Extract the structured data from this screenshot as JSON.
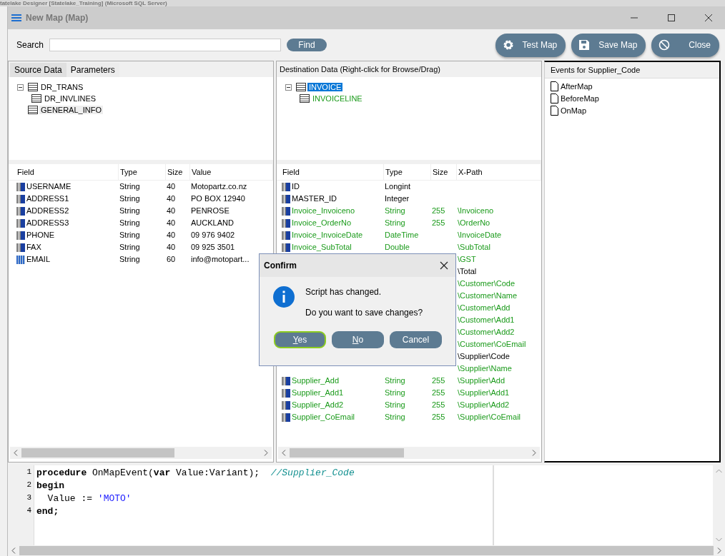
{
  "background_window": {
    "title": "tatelake Designer [Statelake_Training] (Microsoft SQL Server)"
  },
  "window": {
    "title": "New Map (Map)"
  },
  "search": {
    "label": "Search",
    "find_button": "Find"
  },
  "toolbar_buttons": [
    {
      "kind": "gear",
      "label": "Test Map"
    },
    {
      "kind": "save",
      "label": "Save Map"
    },
    {
      "kind": "cancel",
      "label": "Close"
    }
  ],
  "source": {
    "tabs": [
      {
        "label": "Source Data",
        "selected": true
      },
      {
        "label": "Parameters",
        "selected": false
      }
    ],
    "tree": [
      {
        "label": "DR_TRANS",
        "expanded": true,
        "selected": false,
        "children": [
          {
            "label": "DR_INVLINES",
            "selected": false
          }
        ]
      },
      {
        "label": "GENERAL_INFO",
        "selected": true
      }
    ],
    "columns": [
      "Field",
      "Type",
      "Size",
      "Value"
    ],
    "rows": [
      {
        "kind": "field",
        "field": "USERNAME",
        "type": "String",
        "size": "40",
        "value": "Motopartz.co.nz"
      },
      {
        "kind": "field",
        "field": "ADDRESS1",
        "type": "String",
        "size": "40",
        "value": "PO BOX 12940"
      },
      {
        "kind": "field",
        "field": "ADDRESS2",
        "type": "String",
        "size": "40",
        "value": "PENROSE"
      },
      {
        "kind": "field",
        "field": "ADDRESS3",
        "type": "String",
        "size": "40",
        "value": "AUCKLAND"
      },
      {
        "kind": "field",
        "field": "PHONE",
        "type": "String",
        "size": "40",
        "value": "09 976 9402"
      },
      {
        "kind": "field",
        "field": "FAX",
        "type": "String",
        "size": "40",
        "value": "09 925 3501"
      },
      {
        "kind": "grid",
        "field": "EMAIL",
        "type": "String",
        "size": "60",
        "value": "info@motopart..."
      }
    ]
  },
  "destination": {
    "header": "Destination Data   (Right-click for Browse/Drag)",
    "tree": [
      {
        "label": "INVOICE",
        "expanded": true,
        "selected": true,
        "children": [
          {
            "label": "INVOICELINE",
            "selected": false,
            "mapped": true
          }
        ]
      }
    ],
    "columns": [
      "Field",
      "Type",
      "Size",
      "X-Path"
    ],
    "rows": [
      {
        "field": "ID",
        "type": "Longint",
        "size": "",
        "xpath": "",
        "mapped": false
      },
      {
        "field": "MASTER_ID",
        "type": "Integer",
        "size": "",
        "xpath": "",
        "mapped": false
      },
      {
        "field": "Invoice_Invoiceno",
        "type": "String",
        "size": "255",
        "xpath": "\\Invoiceno",
        "mapped": true
      },
      {
        "field": "Invoice_OrderNo",
        "type": "String",
        "size": "255",
        "xpath": "\\OrderNo",
        "mapped": true
      },
      {
        "field": "Invoice_InvoiceDate",
        "type": "DateTime",
        "size": "",
        "xpath": "\\InvoiceDate",
        "mapped": true
      },
      {
        "field": "Invoice_SubTotal",
        "type": "Double",
        "size": "",
        "xpath": "\\SubTotal",
        "mapped": true
      },
      {
        "xpath": "\\GST",
        "mapped": true
      },
      {
        "xpath": "\\Total",
        "mapped": false
      },
      {
        "xpath": "\\Customer\\Code",
        "mapped": true
      },
      {
        "xpath": "\\Customer\\Name",
        "mapped": true
      },
      {
        "xpath": "\\Customer\\Add",
        "mapped": true
      },
      {
        "xpath": "\\Customer\\Add1",
        "mapped": true
      },
      {
        "xpath": "\\Customer\\Add2",
        "mapped": true
      },
      {
        "xpath": "\\Customer\\CoEmail",
        "mapped": true
      },
      {
        "xpath": "\\Supplier\\Code",
        "mapped": false
      },
      {
        "xpath": "\\Supplier\\Name",
        "mapped": true
      },
      {
        "field": "Supplier_Add",
        "type": "String",
        "size": "255",
        "xpath": "\\Supplier\\Add",
        "mapped": true
      },
      {
        "field": "Supplier_Add1",
        "type": "String",
        "size": "255",
        "xpath": "\\Supplier\\Add1",
        "mapped": true
      },
      {
        "field": "Supplier_Add2",
        "type": "String",
        "size": "255",
        "xpath": "\\Supplier\\Add2",
        "mapped": true
      },
      {
        "field": "Supplier_CoEmail",
        "type": "String",
        "size": "255",
        "xpath": "\\Supplier\\CoEmail",
        "mapped": true
      }
    ]
  },
  "events": {
    "header": "Events for Supplier_Code",
    "items": [
      "AfterMap",
      "BeforeMap",
      "OnMap"
    ]
  },
  "code": [
    {
      "number": "1",
      "tokens": [
        {
          "kind": "keyword",
          "text": "procedure"
        },
        {
          "kind": "plain",
          "text": " OnMapEvent("
        },
        {
          "kind": "keyword",
          "text": "var"
        },
        {
          "kind": "plain",
          "text": " Value:Variant);  "
        },
        {
          "kind": "comment",
          "text": "//Supplier_Code"
        }
      ]
    },
    {
      "number": "2",
      "tokens": [
        {
          "kind": "keyword",
          "text": "begin"
        }
      ]
    },
    {
      "number": "3",
      "tokens": [
        {
          "kind": "plain",
          "text": "  Value := "
        },
        {
          "kind": "string",
          "text": "'MOTO'"
        }
      ]
    },
    {
      "number": "4",
      "tokens": [
        {
          "kind": "keyword",
          "text": "end;"
        }
      ]
    }
  ],
  "dialog": {
    "title": "Confirm",
    "message": "Script has changed.",
    "question": "Do you want to save changes?",
    "buttons": [
      {
        "label": "Yes",
        "underlined_initial": true,
        "focused": true
      },
      {
        "label": "No",
        "underlined_initial": true,
        "focused": false
      },
      {
        "label": "Cancel",
        "underlined_initial": false,
        "focused": false
      }
    ]
  }
}
